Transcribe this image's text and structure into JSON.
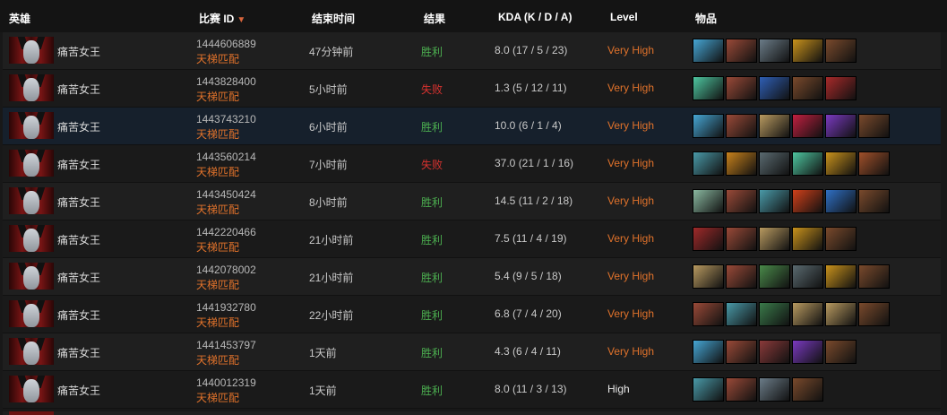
{
  "header": {
    "hero": "英雄",
    "match_id": "比赛 ID",
    "end_time": "结束时间",
    "result": "结果",
    "kda": "KDA (K / D / A)",
    "level": "Level",
    "items": "物品"
  },
  "rows": [
    {
      "hero": "痛苦女王",
      "match_id": "1444606889",
      "match_type": "天梯匹配",
      "time": "47分钟前",
      "result": "胜利",
      "outcome": "win",
      "kda": "8.0 (17 / 5 / 23)",
      "level": "Very High",
      "items": [
        "#46a6d4",
        "#9a4a38",
        "#6b7c88",
        "#c8921c",
        "#7a4a2c"
      ]
    },
    {
      "hero": "痛苦女王",
      "match_id": "1443828400",
      "match_type": "天梯匹配",
      "time": "5小时前",
      "result": "失败",
      "outcome": "lose",
      "kda": "1.3 (5 / 12 / 11)",
      "level": "Very High",
      "items": [
        "#4ec6a0",
        "#9a4a38",
        "#2f5fb5",
        "#7a4a2c",
        "#a82a2a"
      ]
    },
    {
      "hero": "痛苦女王",
      "match_id": "1443743210",
      "match_type": "天梯匹配",
      "time": "6小时前",
      "result": "胜利",
      "outcome": "win",
      "kda": "10.0 (6 / 1 / 4)",
      "level": "Very High",
      "items": [
        "#46a6d4",
        "#9a4a38",
        "#b89a60",
        "#c02040",
        "#7a3ac0",
        "#7a4a2c"
      ]
    },
    {
      "hero": "痛苦女王",
      "match_id": "1443560214",
      "match_type": "天梯匹配",
      "time": "7小时前",
      "result": "失败",
      "outcome": "lose",
      "kda": "37.0 (21 / 1 / 16)",
      "level": "Very High",
      "items": [
        "#4a9aa8",
        "#c8821c",
        "#5a6a70",
        "#4ec6a0",
        "#c8921c",
        "#a0502a"
      ]
    },
    {
      "hero": "痛苦女王",
      "match_id": "1443450424",
      "match_type": "天梯匹配",
      "time": "8小时前",
      "result": "胜利",
      "outcome": "win",
      "kda": "14.5 (11 / 2 / 18)",
      "level": "Very High",
      "items": [
        "#8ab8a0",
        "#9a4a38",
        "#4a9aa8",
        "#d0401a",
        "#2f70c5",
        "#7a4a2c"
      ]
    },
    {
      "hero": "痛苦女王",
      "match_id": "1442220466",
      "match_type": "天梯匹配",
      "time": "21小时前",
      "result": "胜利",
      "outcome": "win",
      "kda": "7.5 (11 / 4 / 19)",
      "level": "Very High",
      "items": [
        "#a02a2a",
        "#9a4a38",
        "#b89a60",
        "#c8921c",
        "#7a4a2c"
      ]
    },
    {
      "hero": "痛苦女王",
      "match_id": "1442078002",
      "match_type": "天梯匹配",
      "time": "21小时前",
      "result": "胜利",
      "outcome": "win",
      "kda": "5.4 (9 / 5 / 18)",
      "level": "Very High",
      "items": [
        "#b89a60",
        "#9a4a38",
        "#4a8a4a",
        "#5a6a70",
        "#c8921c",
        "#7a4a2c"
      ]
    },
    {
      "hero": "痛苦女王",
      "match_id": "1441932780",
      "match_type": "天梯匹配",
      "time": "22小时前",
      "result": "胜利",
      "outcome": "win",
      "kda": "6.8 (7 / 4 / 20)",
      "level": "Very High",
      "items": [
        "#9a4a38",
        "#4a9aa8",
        "#3a7a4a",
        "#b89a60",
        "#b89a60",
        "#7a4a2c"
      ]
    },
    {
      "hero": "痛苦女王",
      "match_id": "1441453797",
      "match_type": "天梯匹配",
      "time": "1天前",
      "result": "胜利",
      "outcome": "win",
      "kda": "4.3 (6 / 4 / 11)",
      "level": "Very High",
      "items": [
        "#46a6d4",
        "#9a4a38",
        "#8a3a3a",
        "#7a3ac0",
        "#7a4a2c"
      ]
    },
    {
      "hero": "痛苦女王",
      "match_id": "1440012319",
      "match_type": "天梯匹配",
      "time": "1天前",
      "result": "胜利",
      "outcome": "win",
      "kda": "8.0 (11 / 3 / 13)",
      "level": "High",
      "items": [
        "#4a9aa8",
        "#9a4a38",
        "#6b7c88",
        "#7a4a2c"
      ]
    }
  ]
}
